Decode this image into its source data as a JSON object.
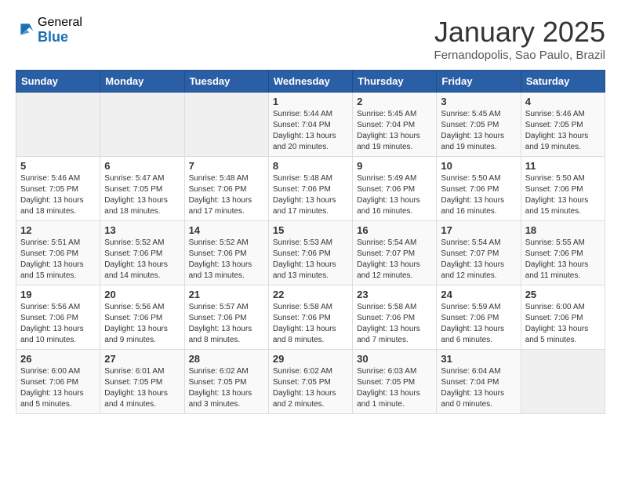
{
  "header": {
    "logo_general": "General",
    "logo_blue": "Blue",
    "month_year": "January 2025",
    "location": "Fernandopolis, Sao Paulo, Brazil"
  },
  "weekdays": [
    "Sunday",
    "Monday",
    "Tuesday",
    "Wednesday",
    "Thursday",
    "Friday",
    "Saturday"
  ],
  "weeks": [
    [
      {
        "day": null,
        "sunrise": null,
        "sunset": null,
        "daylight": null
      },
      {
        "day": null,
        "sunrise": null,
        "sunset": null,
        "daylight": null
      },
      {
        "day": null,
        "sunrise": null,
        "sunset": null,
        "daylight": null
      },
      {
        "day": "1",
        "sunrise": "5:44 AM",
        "sunset": "7:04 PM",
        "daylight": "13 hours and 20 minutes."
      },
      {
        "day": "2",
        "sunrise": "5:45 AM",
        "sunset": "7:04 PM",
        "daylight": "13 hours and 19 minutes."
      },
      {
        "day": "3",
        "sunrise": "5:45 AM",
        "sunset": "7:05 PM",
        "daylight": "13 hours and 19 minutes."
      },
      {
        "day": "4",
        "sunrise": "5:46 AM",
        "sunset": "7:05 PM",
        "daylight": "13 hours and 19 minutes."
      }
    ],
    [
      {
        "day": "5",
        "sunrise": "5:46 AM",
        "sunset": "7:05 PM",
        "daylight": "13 hours and 18 minutes."
      },
      {
        "day": "6",
        "sunrise": "5:47 AM",
        "sunset": "7:05 PM",
        "daylight": "13 hours and 18 minutes."
      },
      {
        "day": "7",
        "sunrise": "5:48 AM",
        "sunset": "7:06 PM",
        "daylight": "13 hours and 17 minutes."
      },
      {
        "day": "8",
        "sunrise": "5:48 AM",
        "sunset": "7:06 PM",
        "daylight": "13 hours and 17 minutes."
      },
      {
        "day": "9",
        "sunrise": "5:49 AM",
        "sunset": "7:06 PM",
        "daylight": "13 hours and 16 minutes."
      },
      {
        "day": "10",
        "sunrise": "5:50 AM",
        "sunset": "7:06 PM",
        "daylight": "13 hours and 16 minutes."
      },
      {
        "day": "11",
        "sunrise": "5:50 AM",
        "sunset": "7:06 PM",
        "daylight": "13 hours and 15 minutes."
      }
    ],
    [
      {
        "day": "12",
        "sunrise": "5:51 AM",
        "sunset": "7:06 PM",
        "daylight": "13 hours and 15 minutes."
      },
      {
        "day": "13",
        "sunrise": "5:52 AM",
        "sunset": "7:06 PM",
        "daylight": "13 hours and 14 minutes."
      },
      {
        "day": "14",
        "sunrise": "5:52 AM",
        "sunset": "7:06 PM",
        "daylight": "13 hours and 13 minutes."
      },
      {
        "day": "15",
        "sunrise": "5:53 AM",
        "sunset": "7:06 PM",
        "daylight": "13 hours and 13 minutes."
      },
      {
        "day": "16",
        "sunrise": "5:54 AM",
        "sunset": "7:07 PM",
        "daylight": "13 hours and 12 minutes."
      },
      {
        "day": "17",
        "sunrise": "5:54 AM",
        "sunset": "7:07 PM",
        "daylight": "13 hours and 12 minutes."
      },
      {
        "day": "18",
        "sunrise": "5:55 AM",
        "sunset": "7:06 PM",
        "daylight": "13 hours and 11 minutes."
      }
    ],
    [
      {
        "day": "19",
        "sunrise": "5:56 AM",
        "sunset": "7:06 PM",
        "daylight": "13 hours and 10 minutes."
      },
      {
        "day": "20",
        "sunrise": "5:56 AM",
        "sunset": "7:06 PM",
        "daylight": "13 hours and 9 minutes."
      },
      {
        "day": "21",
        "sunrise": "5:57 AM",
        "sunset": "7:06 PM",
        "daylight": "13 hours and 8 minutes."
      },
      {
        "day": "22",
        "sunrise": "5:58 AM",
        "sunset": "7:06 PM",
        "daylight": "13 hours and 8 minutes."
      },
      {
        "day": "23",
        "sunrise": "5:58 AM",
        "sunset": "7:06 PM",
        "daylight": "13 hours and 7 minutes."
      },
      {
        "day": "24",
        "sunrise": "5:59 AM",
        "sunset": "7:06 PM",
        "daylight": "13 hours and 6 minutes."
      },
      {
        "day": "25",
        "sunrise": "6:00 AM",
        "sunset": "7:06 PM",
        "daylight": "13 hours and 5 minutes."
      }
    ],
    [
      {
        "day": "26",
        "sunrise": "6:00 AM",
        "sunset": "7:06 PM",
        "daylight": "13 hours and 5 minutes."
      },
      {
        "day": "27",
        "sunrise": "6:01 AM",
        "sunset": "7:05 PM",
        "daylight": "13 hours and 4 minutes."
      },
      {
        "day": "28",
        "sunrise": "6:02 AM",
        "sunset": "7:05 PM",
        "daylight": "13 hours and 3 minutes."
      },
      {
        "day": "29",
        "sunrise": "6:02 AM",
        "sunset": "7:05 PM",
        "daylight": "13 hours and 2 minutes."
      },
      {
        "day": "30",
        "sunrise": "6:03 AM",
        "sunset": "7:05 PM",
        "daylight": "13 hours and 1 minute."
      },
      {
        "day": "31",
        "sunrise": "6:04 AM",
        "sunset": "7:04 PM",
        "daylight": "13 hours and 0 minutes."
      },
      {
        "day": null,
        "sunrise": null,
        "sunset": null,
        "daylight": null
      }
    ]
  ]
}
